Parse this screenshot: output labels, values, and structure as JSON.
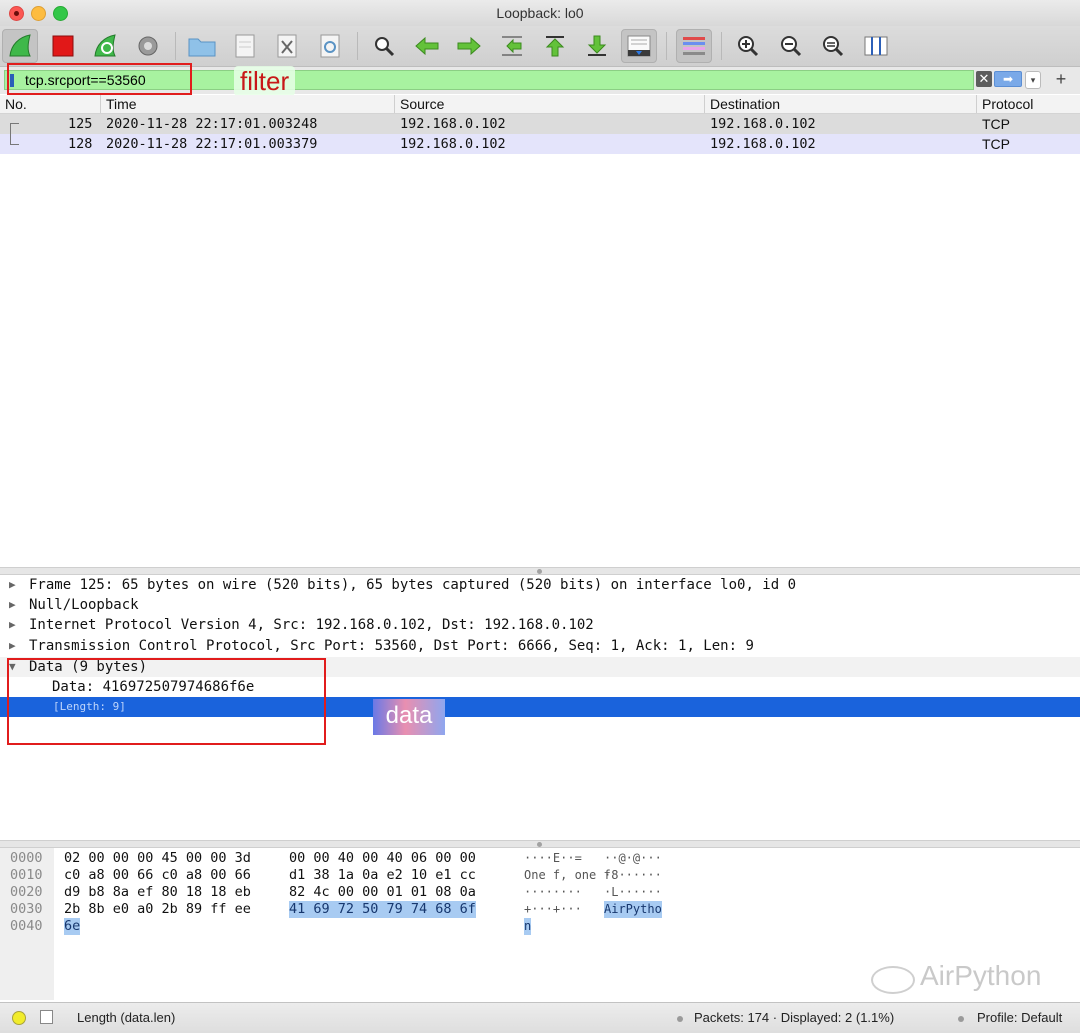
{
  "window": {
    "title": "Loopback: lo0"
  },
  "toolbar": {
    "items": [
      "start-capture",
      "stop-capture",
      "restart-capture",
      "capture-options",
      "open-file",
      "save-file",
      "close-file",
      "reload-file",
      "find-packet",
      "go-back",
      "go-forward",
      "go-to-packet",
      "go-first",
      "go-last",
      "auto-scroll",
      "colorize",
      "zoom-in",
      "zoom-out",
      "normal-size",
      "resize-columns"
    ]
  },
  "filter": {
    "value": "tcp.srcport==53560",
    "annotation": "filter",
    "clear_glyph": "✕",
    "apply_glyph": "➡",
    "recent_glyph": "▾",
    "add_glyph": "+"
  },
  "packet_list": {
    "columns": [
      "No.",
      "Time",
      "Source",
      "Destination",
      "Protocol"
    ],
    "rows": [
      {
        "no": "125",
        "time": "2020-11-28 22:17:01.003248",
        "source": "192.168.0.102",
        "destination": "192.168.0.102",
        "protocol": "TCP"
      },
      {
        "no": "128",
        "time": "2020-11-28 22:17:01.003379",
        "source": "192.168.0.102",
        "destination": "192.168.0.102",
        "protocol": "TCP"
      }
    ]
  },
  "details": {
    "rows": [
      {
        "tri": "▶",
        "text": "Frame 125: 65 bytes on wire (520 bits), 65 bytes captured (520 bits) on interface lo0, id 0"
      },
      {
        "tri": "▶",
        "text": "Null/Loopback"
      },
      {
        "tri": "▶",
        "text": "Internet Protocol Version 4, Src: 192.168.0.102, Dst: 192.168.0.102"
      },
      {
        "tri": "▶",
        "text": "Transmission Control Protocol, Src Port: 53560, Dst Port: 6666, Seq: 1, Ack: 1, Len: 9"
      },
      {
        "tri": "▼",
        "text": "Data (9 bytes)"
      }
    ],
    "data_value": "Data: 416972507974686f6e",
    "length_line": "[Length: 9]",
    "annotation": "data"
  },
  "bytes": {
    "rows": [
      {
        "offset": "0000",
        "hex_a": "02 00 00 00 45 00 00 3d",
        "hex_b": "00 00 40 00 40 06 00 00",
        "ascii_a": "····E··=",
        "ascii_b": "··@·@···"
      },
      {
        "offset": "0010",
        "hex_a": "c0 a8 00 66 c0 a8 00 66",
        "hex_b": "d1 38 1a 0a e2 10 e1 cc",
        "ascii_a": "One f, one f",
        "ascii_b": "·8······"
      },
      {
        "offset": "0020",
        "hex_a": "d9 b8 8a ef 80 18 18 eb",
        "hex_b": "82 4c 00 00 01 01 08 0a",
        "ascii_a": "········",
        "ascii_b": "·L······"
      },
      {
        "offset": "0030",
        "hex_a": "2b 8b e0 a0 2b 89 ff ee",
        "hex_b": "41 69 72 50 79 74 68 6f",
        "ascii_a": "+···+···",
        "ascii_b": "AirPytho"
      },
      {
        "offset": "0040",
        "hex_a": "6e",
        "hex_b": "",
        "ascii_a": "n",
        "ascii_b": ""
      }
    ]
  },
  "watermark": "AirPython",
  "status": {
    "field": "Length (data.len)",
    "packets": "Packets: 174 · Displayed: 2 (1.1%)",
    "profile": "Profile: Default"
  },
  "colors": {
    "filter_bg": "#a8f2a0",
    "selected_row": "#1a63dc",
    "annotation_red": "#e11c1c"
  }
}
